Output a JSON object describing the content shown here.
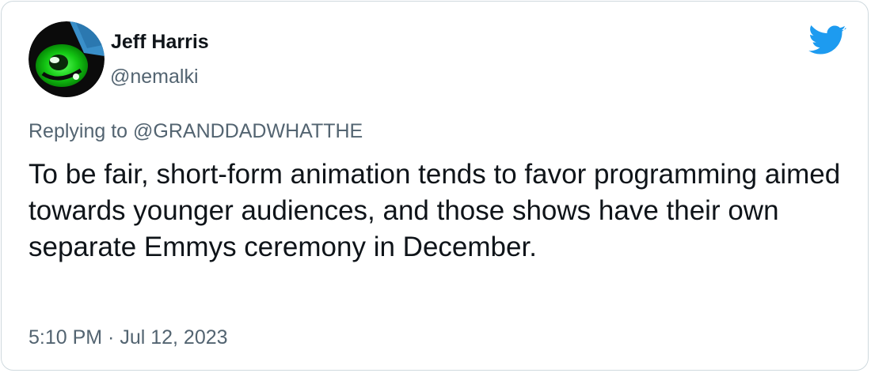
{
  "tweet": {
    "author": {
      "display_name": "Jeff Harris",
      "handle": "@nemalki",
      "avatar": "green-eye-avatar"
    },
    "reply": {
      "prefix": "Replying to ",
      "mention": "@GRANDDADWHATTHE"
    },
    "text": "To be fair, short-form animation tends to favor programming aimed towards younger audiences, and those shows have their own separate Emmys ceremony in December.",
    "timestamp": "5:10 PM · Jul 12, 2023"
  },
  "icons": {
    "brand_logo": "twitter-bird-icon"
  },
  "colors": {
    "brand": "#1d9bf0",
    "text_primary": "#0f1419",
    "text_secondary": "#536471",
    "border": "#cfd9de"
  }
}
